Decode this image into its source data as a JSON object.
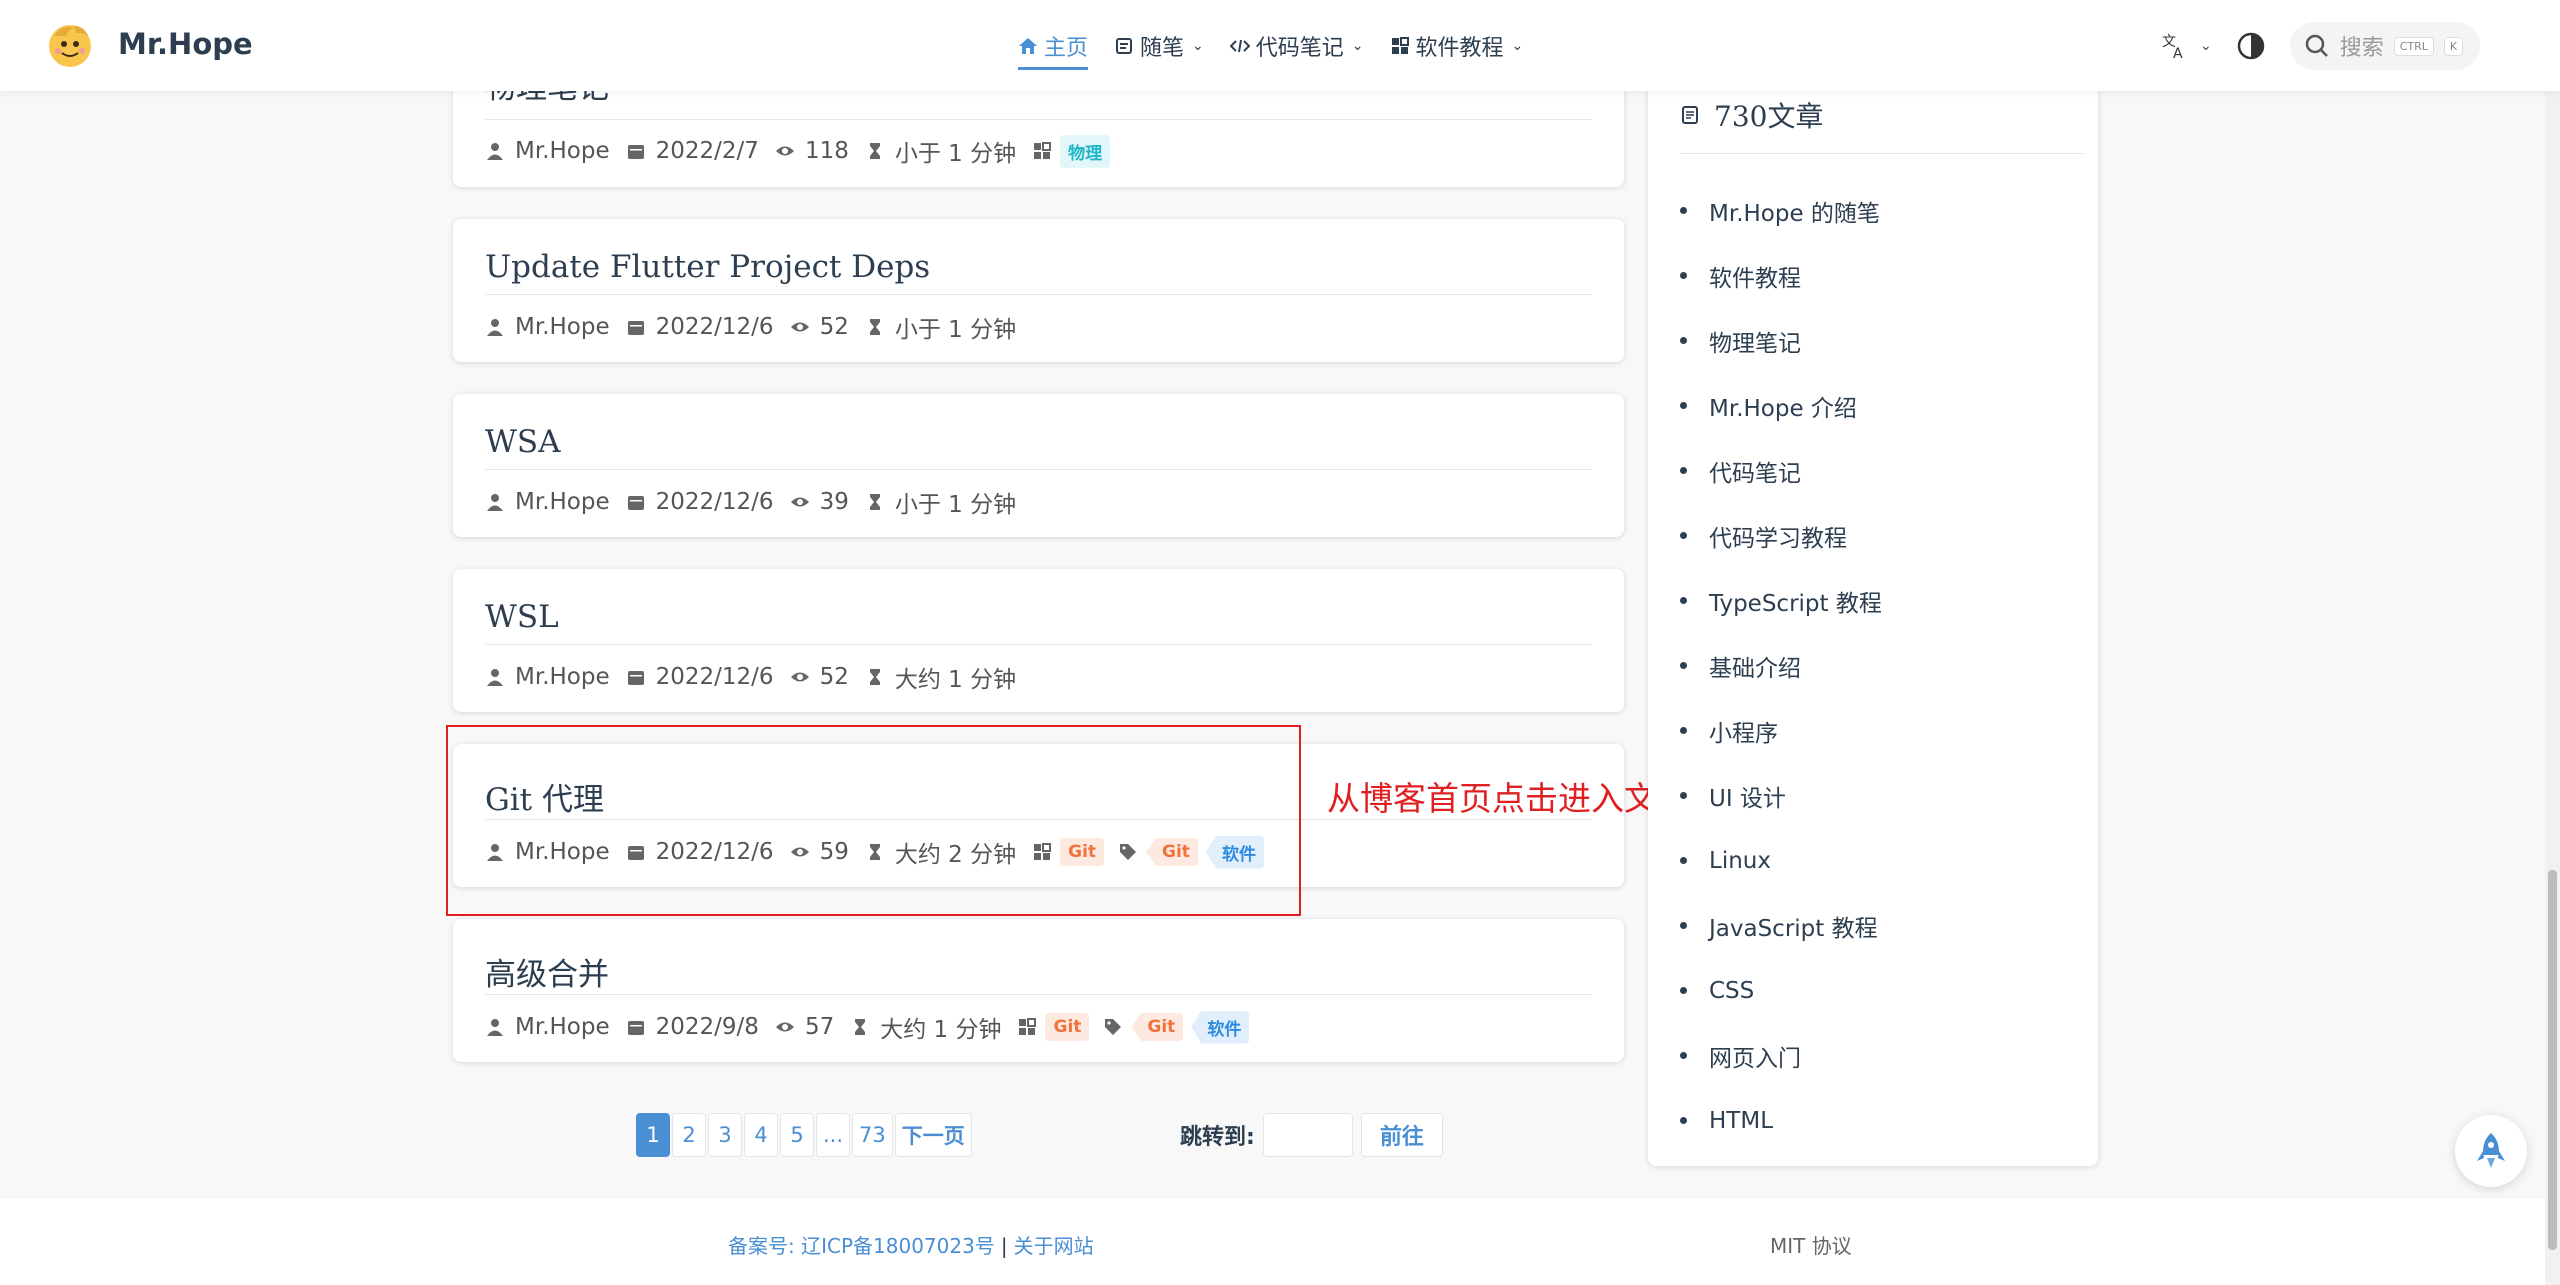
{
  "navbar": {
    "brand": "Mr.Hope",
    "links": [
      {
        "label": "主页",
        "icon": "home-icon",
        "active": true
      },
      {
        "label": "随笔",
        "icon": "notebook-icon"
      },
      {
        "label": "代码笔记",
        "icon": "code-icon"
      },
      {
        "label": "软件教程",
        "icon": "grid-icon"
      }
    ],
    "search_placeholder": "搜索",
    "kbd_ctrl": "CTRL",
    "kbd_k": "K"
  },
  "articles": [
    {
      "title": "物理笔记",
      "author": "Mr.Hope",
      "date": "2022/2/7",
      "views": "118",
      "read": "小于 1 分钟",
      "category": "物理",
      "tags": []
    },
    {
      "title": "Update Flutter Project Deps",
      "author": "Mr.Hope",
      "date": "2022/12/6",
      "views": "52",
      "read": "小于 1 分钟",
      "category": "",
      "tags": []
    },
    {
      "title": "WSA",
      "author": "Mr.Hope",
      "date": "2022/12/6",
      "views": "39",
      "read": "小于 1 分钟",
      "category": "",
      "tags": []
    },
    {
      "title": "WSL",
      "author": "Mr.Hope",
      "date": "2022/12/6",
      "views": "52",
      "read": "大约 1 分钟",
      "category": "",
      "tags": []
    },
    {
      "title": "Git 代理",
      "author": "Mr.Hope",
      "date": "2022/12/6",
      "views": "59",
      "read": "大约 2 分钟",
      "category": "Git",
      "tags": [
        "Git",
        "软件"
      ]
    },
    {
      "title": "高级合并",
      "author": "Mr.Hope",
      "date": "2022/9/8",
      "views": "57",
      "read": "大约 1 分钟",
      "category": "Git",
      "tags": [
        "Git",
        "软件"
      ]
    }
  ],
  "annotation": "从博客首页点击进入文章",
  "pagination": {
    "pages": [
      "1",
      "2",
      "3",
      "4",
      "5",
      "...",
      "73",
      "下一页"
    ],
    "jump_label": "跳转到:",
    "go_label": "前往"
  },
  "sidebar": {
    "count": "730",
    "count_suffix": "文章",
    "items": [
      "Mr.Hope 的随笔",
      "软件教程",
      "物理笔记",
      "Mr.Hope 介绍",
      "代码笔记",
      "代码学习教程",
      "TypeScript 教程",
      "基础介绍",
      "小程序",
      "UI 设计",
      "Linux",
      "JavaScript 教程",
      "CSS",
      "网页入门",
      "HTML"
    ]
  },
  "footer": {
    "icp": "备案号: 辽ICP备18007023号",
    "sep": "|",
    "about": "关于网站",
    "license": "MIT 协议"
  },
  "colors": {
    "accent": "#4a8fd4",
    "annotation": "#e02020"
  }
}
